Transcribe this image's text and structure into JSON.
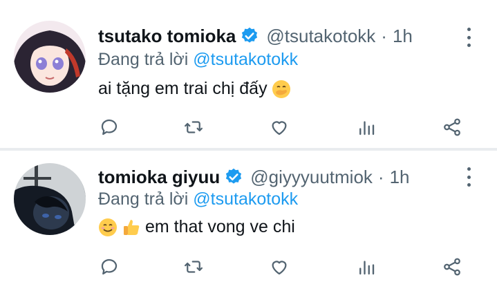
{
  "tweets": [
    {
      "name": "tsutako tomioka",
      "handle": "@tsutakotokk",
      "separator": "·",
      "time": "1h",
      "reply_prefix": "Đang trả lời",
      "reply_to": "@tsutakotokk",
      "text": "ai tặng em trai chị đấy",
      "emojis": [
        "hand-over-mouth-emoji"
      ]
    },
    {
      "name": "tomioka giyuu",
      "handle": "@giyyyuutmiok",
      "separator": "·",
      "time": "1h",
      "reply_prefix": "Đang trả lời",
      "reply_to": "@tsutakotokk",
      "text": "em that vong ve chi",
      "emojis": [
        "smiling-face-emoji",
        "thumbs-up-emoji"
      ]
    }
  ],
  "colors": {
    "accent": "#1d9bf0",
    "secondary_text": "#536471",
    "primary_text": "#0f1419",
    "divider": "#e9ecef"
  },
  "icons": [
    "verified-badge-icon",
    "more-options-icon",
    "reply-icon",
    "retweet-icon",
    "like-icon",
    "views-icon",
    "share-icon"
  ]
}
